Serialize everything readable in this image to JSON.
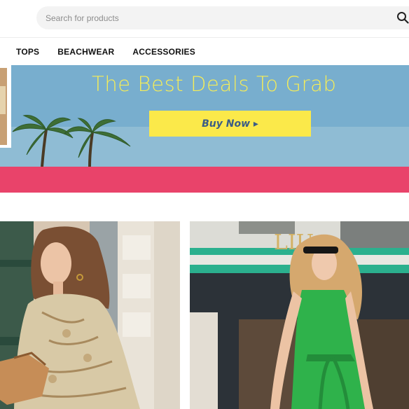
{
  "search": {
    "placeholder": "Search for products",
    "icon": "search-icon"
  },
  "nav": {
    "items": [
      "TOPS",
      "BEACHWEAR",
      "ACCESSORIES"
    ]
  },
  "hero": {
    "title": "The Best Deals To Grab",
    "button_label": "Buy Now ▸",
    "colors": {
      "title": "#f6ee5a",
      "button": "#fbe94a",
      "button_text": "#3b5c86",
      "band": "#e9436a"
    }
  },
  "products": [
    {
      "image": "woman-in-paisley-dress-photo"
    },
    {
      "image": "woman-in-green-dress-photo"
    }
  ]
}
